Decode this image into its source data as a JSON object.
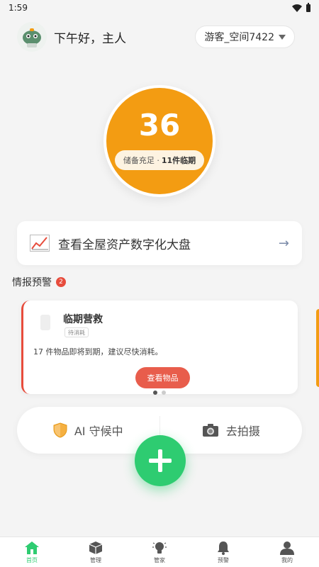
{
  "status": {
    "time": "1:59"
  },
  "header": {
    "greeting": "下午好，主人",
    "space_label": "游客_空间7422"
  },
  "score": {
    "value": "36",
    "pill_prefix": "储备充足 · ",
    "pill_bold": "11件临期"
  },
  "dashboard": {
    "label": "查看全屋资产数字化大盘",
    "arrow": "→"
  },
  "alerts": {
    "title": "情报预警",
    "count": "2",
    "card": {
      "title": "临期营救",
      "tag": "待消耗",
      "description": "17 件物品即将到期，建议尽快消耗。",
      "button": "查看物品"
    }
  },
  "actions": {
    "guard_label": "AI 守候中",
    "photo_label": "去拍摄"
  },
  "nav": {
    "items": [
      {
        "label": "首页",
        "icon": "home-icon",
        "active": true
      },
      {
        "label": "管理",
        "icon": "box-icon",
        "active": false
      },
      {
        "label": "管家",
        "icon": "bulb-icon",
        "active": false
      },
      {
        "label": "预警",
        "icon": "bell-icon",
        "active": false
      },
      {
        "label": "我的",
        "icon": "user-icon",
        "active": false
      }
    ]
  },
  "colors": {
    "accent_green": "#2ecc71",
    "score_orange": "#f39c12",
    "alert_red": "#e74c3c"
  }
}
